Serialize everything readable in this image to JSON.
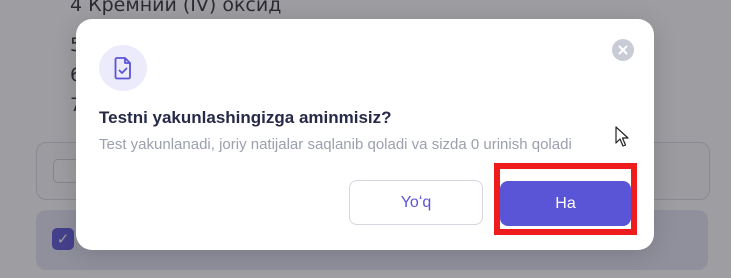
{
  "background": {
    "heading_line": "4 Кремний (IV) оксид",
    "line_5": "5",
    "line_6": "6",
    "line_7": "7"
  },
  "modal": {
    "icon": "document-check-icon",
    "close_icon": "close-icon",
    "title": "Testni yakunlashingizga aminmisiz?",
    "subtitle": "Test yakunlanadi, joriy natijalar saqlanib qoladi va sizda 0 urinish qoladi",
    "cancel_label": "Yoʻq",
    "confirm_label": "Ha"
  },
  "colors": {
    "accent": "#5a54d6",
    "highlight": "#ee1c1c",
    "title": "#262a48",
    "subtitle": "#9ca0ae"
  }
}
